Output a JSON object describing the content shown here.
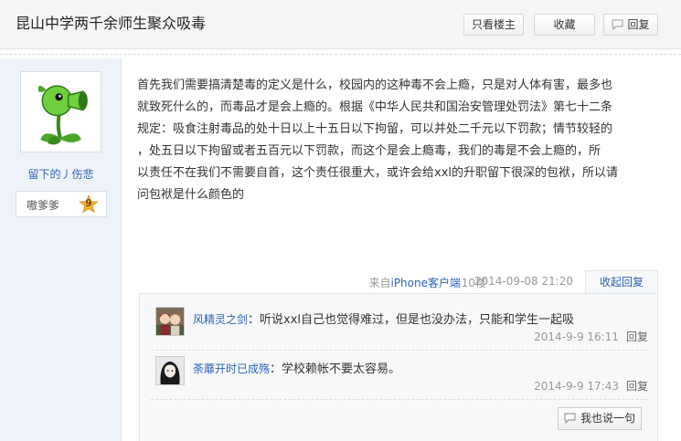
{
  "thread": {
    "title": "昆山中学两千余师生聚众吸毒"
  },
  "header_buttons": {
    "only_author": "只看楼主",
    "favorite": "收藏",
    "reply": "回复"
  },
  "author": {
    "name": "留下的丿伤悲",
    "badge_label": "嗷爹爹",
    "level": "9"
  },
  "post": {
    "lines": [
      "首先我们需要搞清楚毒的定义是什么，校园内的这种毒不会上瘾，只是对人体有害，最多也",
      "就致死什么的，而毒品才是会上瘾的。根据《中华人民共和国治安管理处罚法》第七十二条",
      "规定：吸食注射毒品的处十日以上十五日以下拘留，可以并处二千元以下罚款；情节较轻的",
      "，处五日以下拘留或者五百元以下罚款，而这个是会上瘾毒，我们的毒是不会上瘾的，所",
      "以责任不在我们不需要自首，这个责任很重大，或许会给xxl的升职留下很深的包袱，所以请",
      "问包袱是什么颜色的"
    ]
  },
  "tail": {
    "source_prefix": "来自",
    "source_link": "iPhone客户端",
    "floor": "10楼",
    "time": "2014-09-08 21:20",
    "collapse_reply": "收起回复"
  },
  "comments": [
    {
      "name": "风精灵之剑",
      "text": "听说xxl自己也觉得难过，但是也没办法，只能和学生一起吸",
      "time": "2014-9-9 16:11",
      "reply": "回复"
    },
    {
      "name": "荼蘼开时已成殇",
      "text": "学校赖帐不要太容易。",
      "time": "2014-9-9 17:43",
      "reply": "回复"
    }
  ],
  "say_button": "我也说一句",
  "colors": {
    "link": "#2d64b3",
    "sidebar_bg": "#eef3fa",
    "meta": "#999999"
  }
}
